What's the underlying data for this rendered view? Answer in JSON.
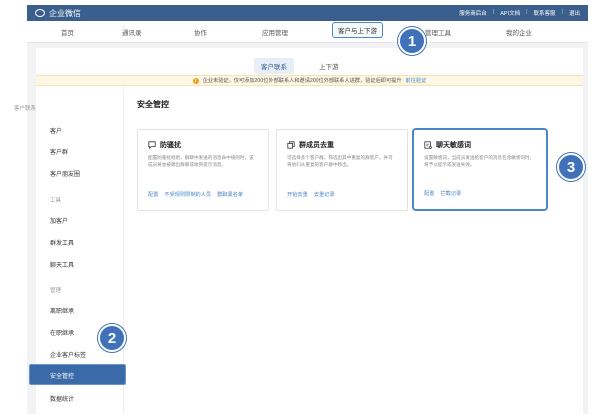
{
  "topbar": {
    "brand": "企业微信",
    "links": [
      "服务商后台",
      "API文档",
      "联系客服",
      "退出"
    ]
  },
  "nav": {
    "items": [
      "首页",
      "通讯录",
      "协作",
      "应用管理",
      "客户与上下游",
      "管理工具",
      "我的企业"
    ]
  },
  "subtabs": [
    "客户联系",
    "上下游"
  ],
  "notice": {
    "icon": "!",
    "text": "企业未验证，仅可添加200位外部联系人和邀请200位外部联系人进群，验证后即可提升",
    "link": "前往验证"
  },
  "sidebar": {
    "items": [
      {
        "label": "客户联系",
        "type": "group"
      },
      {
        "label": "客户",
        "type": "item"
      },
      {
        "label": "客户群",
        "type": "item"
      },
      {
        "label": "客户朋友圈",
        "type": "item"
      },
      {
        "label": "工具",
        "type": "group"
      },
      {
        "label": "加客户",
        "type": "item"
      },
      {
        "label": "群发工具",
        "type": "item"
      },
      {
        "label": "聊天工具",
        "type": "item"
      },
      {
        "label": "管理",
        "type": "group"
      },
      {
        "label": "离职继承",
        "type": "item"
      },
      {
        "label": "在职继承",
        "type": "item"
      },
      {
        "label": "企业客户标签",
        "type": "item"
      },
      {
        "label": "安全管控",
        "type": "active"
      },
      {
        "label": "数据统计",
        "type": "item"
      }
    ]
  },
  "main": {
    "title": "安全管控",
    "cards": [
      {
        "title": "防骚扰",
        "icon": "chat-bubble-icon",
        "desc": "配置防骚扰规则，群聊中发送的消息命中规则时，该成员将会被踢出群聊或收到提示消息。",
        "actions": [
          "配置",
          "不受规则限制的人员",
          "群聊黑名单"
        ]
      },
      {
        "title": "群成员去重",
        "icon": "copy-icon",
        "desc": "可选择多个客户群，筛选出其中重复的群客户，并可将他们从重复的客户群中移出。",
        "actions": [
          "开始去重",
          "去重记录"
        ]
      },
      {
        "title": "聊天敏感词",
        "icon": "sensitive-word-icon",
        "desc": "设置敏感词，当成员发送给客户的消息包含敏感词时，将予以提示或发送失败。",
        "actions": [
          "配置",
          "拦截记录"
        ]
      }
    ]
  },
  "badges": [
    "1",
    "2",
    "3"
  ],
  "colors": {
    "topbar": "#3b5f8c",
    "accent": "#4a86c8",
    "badge": "#3f72b8",
    "notice_bg": "#fdf6e3"
  }
}
